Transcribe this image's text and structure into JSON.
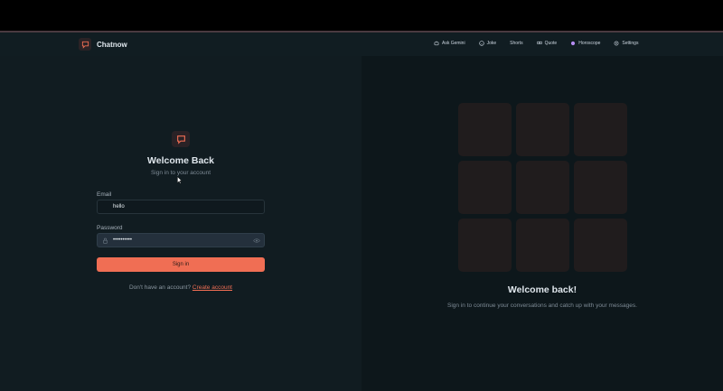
{
  "brand": {
    "name": "Chatnow",
    "icon": "chat-bubble-icon"
  },
  "nav": {
    "items": [
      {
        "label": "Ask Gemini",
        "icon": "robot-icon"
      },
      {
        "label": "Joke",
        "icon": "smiley-icon"
      },
      {
        "label": "Shorts",
        "icon": ""
      },
      {
        "label": "Quote",
        "icon": "quote-icon"
      },
      {
        "label": "Horoscope",
        "icon": "zodiac-icon"
      },
      {
        "label": "Settings",
        "icon": "gear-icon"
      }
    ]
  },
  "login": {
    "title": "Welcome Back",
    "subtitle": "Sign in to your account",
    "email_label": "Email",
    "email_value": "hello",
    "password_label": "Password",
    "password_value": "••••••••••",
    "signin_label": "Sign in",
    "signup_prompt": "Don't have an account?",
    "signup_link": "Create account"
  },
  "hero": {
    "title": "Welcome back!",
    "description": "Sign in to continue your conversations and catch up with your messages."
  },
  "colors": {
    "accent": "#f06e54",
    "background": "#0f1a1f"
  }
}
